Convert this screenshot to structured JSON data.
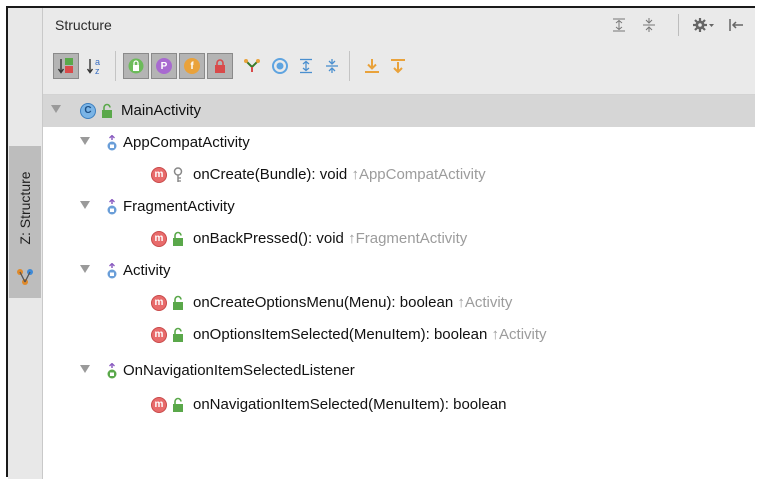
{
  "header": {
    "title": "Structure"
  },
  "side_tab": {
    "label": "Z: Structure"
  },
  "tree": {
    "root": {
      "label": "MainActivity"
    },
    "groups": [
      {
        "label": "AppCompatActivity",
        "members": [
          {
            "signature": "onCreate(Bundle): void",
            "inherited": "AppCompatActivity"
          }
        ]
      },
      {
        "label": "FragmentActivity",
        "members": [
          {
            "signature": "onBackPressed(): void",
            "inherited": "FragmentActivity"
          }
        ]
      },
      {
        "label": "Activity",
        "members": [
          {
            "signature": "onCreateOptionsMenu(Menu): boolean",
            "inherited": "Activity"
          },
          {
            "signature": "onOptionsItemSelected(MenuItem): boolean",
            "inherited": "Activity"
          }
        ]
      },
      {
        "label": "OnNavigationItemSelectedListener",
        "members": [
          {
            "signature": "onNavigationItemSelected(MenuItem): boolean",
            "inherited": ""
          }
        ]
      }
    ]
  },
  "icons": {
    "class_badge": "C",
    "method_badge": "m",
    "toolbar_p": "P",
    "toolbar_f": "f"
  },
  "colors": {
    "method_badge": "#e86b6b",
    "class_badge": "#7ab4e6",
    "inherited_text": "#9c9c9c",
    "selected_row": "#d6d6d6"
  }
}
